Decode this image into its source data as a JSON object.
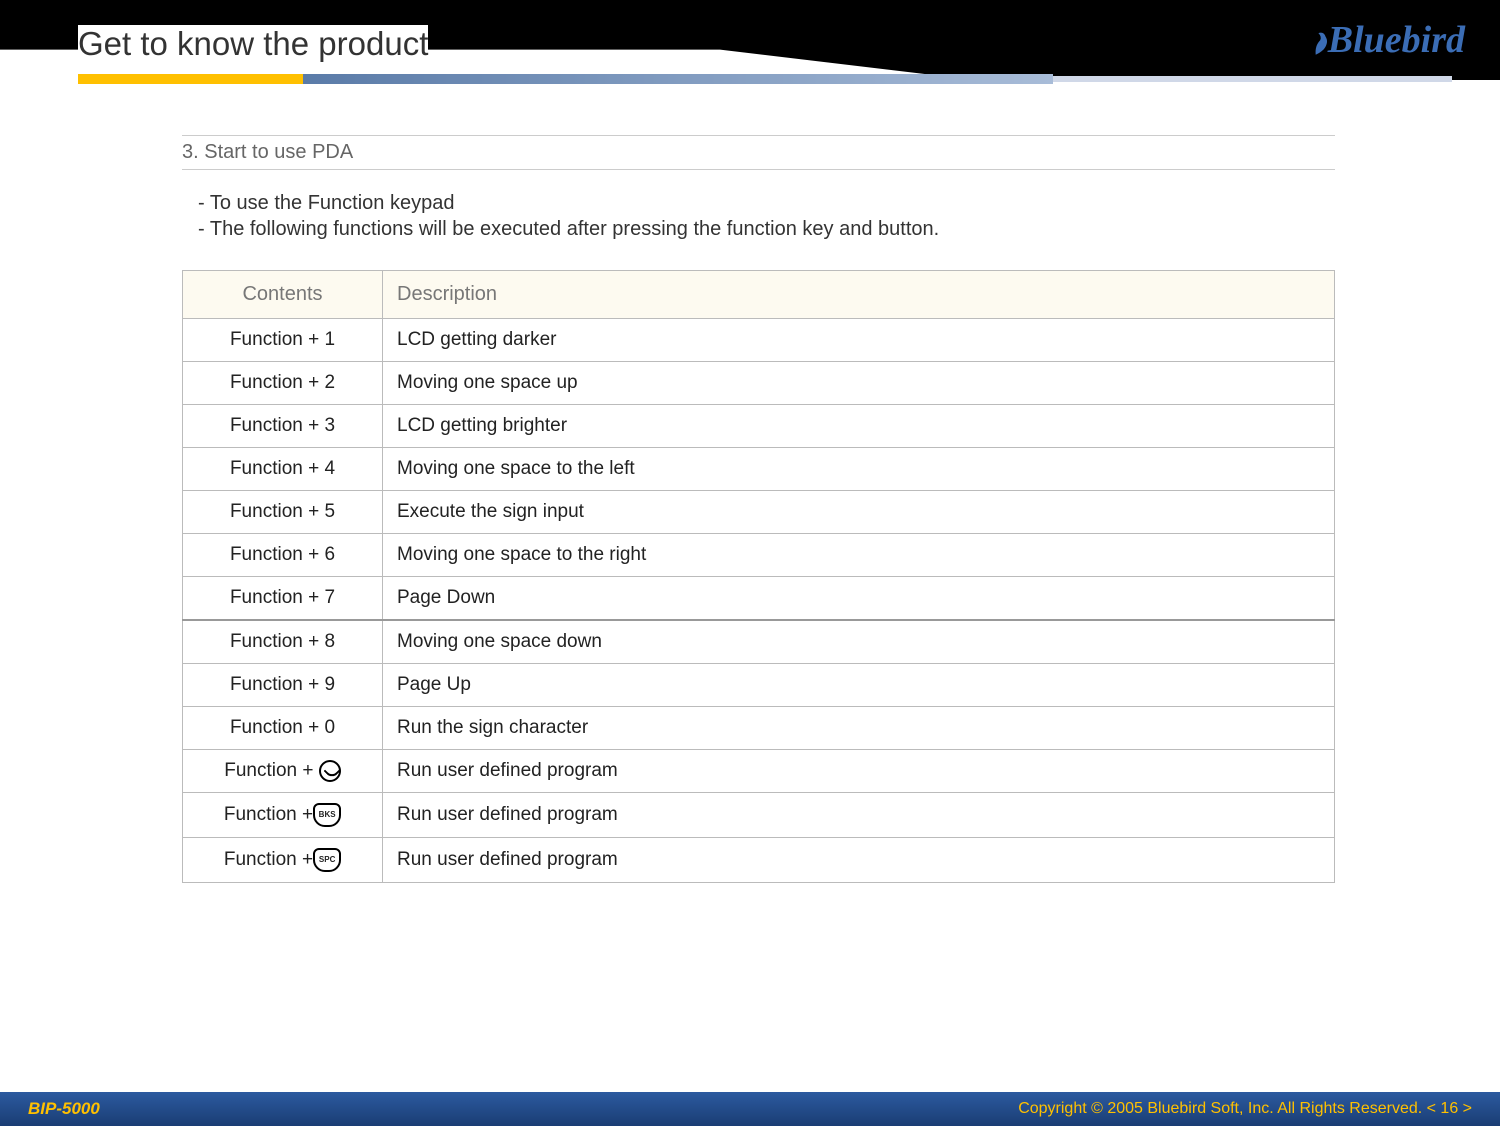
{
  "brand": "Bluebird",
  "page_title": "Get to know the product",
  "section": {
    "heading": "3. Start to use PDA",
    "lines": [
      "- To use the Function keypad",
      "- The following functions will be executed after pressing the function key and button."
    ]
  },
  "table": {
    "headers": [
      "Contents",
      "Description"
    ],
    "rows": [
      {
        "key": "Function + 1",
        "desc": "LCD getting darker",
        "icon": null
      },
      {
        "key": "Function + 2",
        "desc": "Moving one space up",
        "icon": null
      },
      {
        "key": "Function + 3",
        "desc": "LCD getting brighter",
        "icon": null
      },
      {
        "key": "Function + 4",
        "desc": "Moving one space to the left",
        "icon": null
      },
      {
        "key": "Function + 5",
        "desc": "Execute the sign input",
        "icon": null
      },
      {
        "key": "Function + 6",
        "desc": "Moving one space to the right",
        "icon": null
      },
      {
        "key": "Function + 7",
        "desc": "Page Down",
        "icon": null
      },
      {
        "key": "Function + 8",
        "desc": "Moving one space down",
        "icon": null
      },
      {
        "key": "Function + 9",
        "desc": "Page Up",
        "icon": null
      },
      {
        "key": "Function + 0",
        "desc": "Run the sign character",
        "icon": null
      },
      {
        "key": "Function + ",
        "desc": "Run user defined program",
        "icon": "phone"
      },
      {
        "key": "Function +",
        "desc": "Run user defined program",
        "icon": "bks"
      },
      {
        "key": "Function +",
        "desc": "Run user defined program",
        "icon": "spc"
      }
    ]
  },
  "footer": {
    "left": "BIP-5000",
    "right": "Copyright © 2005 Bluebird Soft, Inc. All Rights Reserved.   < 16 >"
  }
}
